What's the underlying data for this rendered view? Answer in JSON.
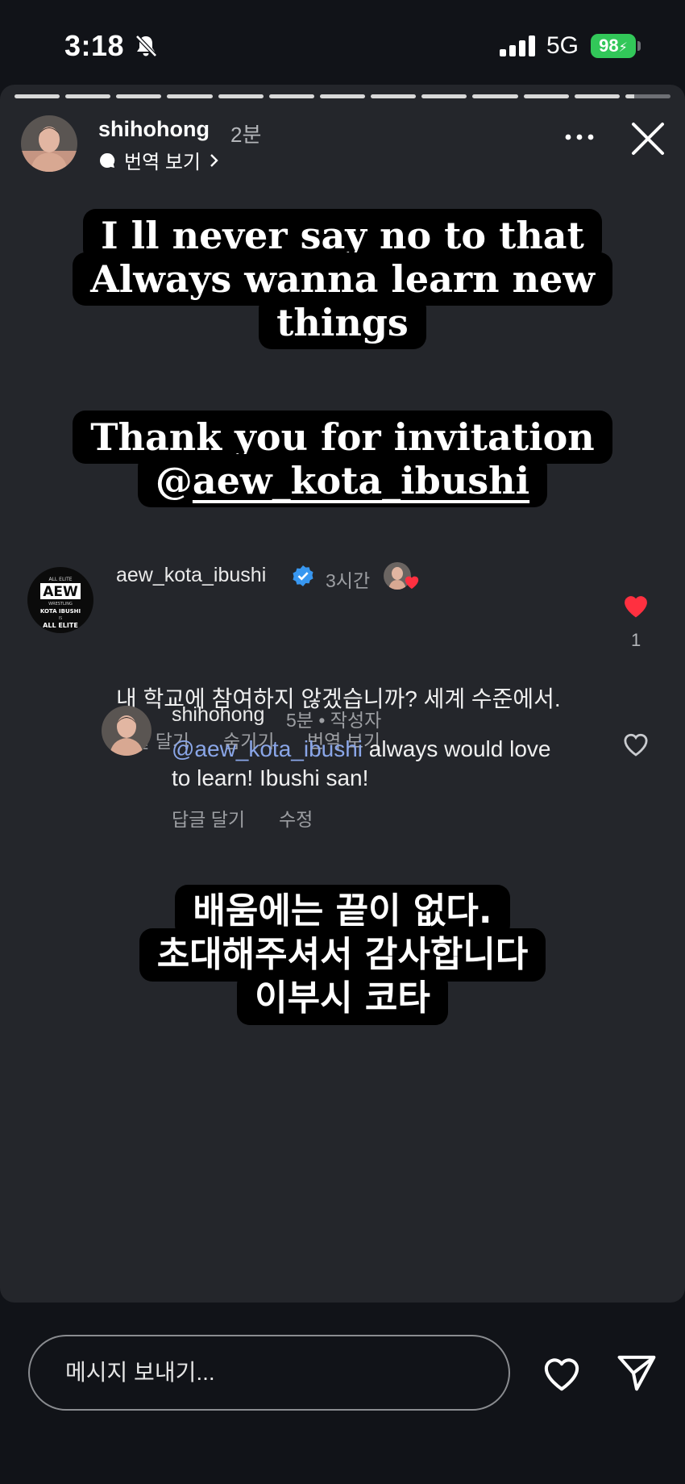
{
  "status": {
    "time": "3:18",
    "network": "5G",
    "battery": "98"
  },
  "story": {
    "progress_segments": 13,
    "username": "shihohong",
    "posted": "2분",
    "translate": "번역 보기"
  },
  "stickers": {
    "s1": [
      "I ll never say no to that",
      "Always wanna learn new",
      "things"
    ],
    "s2_line1": "Thank you for invitation",
    "s2_mention_symbol": "@",
    "s2_mention": "aew_kota_ibushi",
    "s3": [
      "배움에는 끝이 없다.",
      "초대해주셔서 감사합니다",
      "이부시 코타"
    ]
  },
  "comment1": {
    "user": "aew_kota_ibushi",
    "time": "3시간",
    "text": "내 학교에 참여하지 않겠습니까? 세계 수준에서.",
    "reply": "답글 달기",
    "hide": "숨기기",
    "translate": "번역 보기",
    "likes": "1",
    "avatar_text": [
      "ALL ELITE",
      "AEW",
      "WRESTLING",
      "KOTA IBUSHI",
      "IS",
      "ALL ELITE"
    ]
  },
  "comment2": {
    "user": "shihohong",
    "meta": "5분 • 작성자",
    "mention": "@aew_kota_ibushi",
    "text": " always would love to learn! Ibushi san!",
    "reply": "답글 달기",
    "edit": "수정"
  },
  "bottom": {
    "placeholder": "메시지 보내기..."
  },
  "colors": {
    "heart": "#ff3040",
    "battery": "#32c759",
    "mention": "#8aa6e8"
  }
}
